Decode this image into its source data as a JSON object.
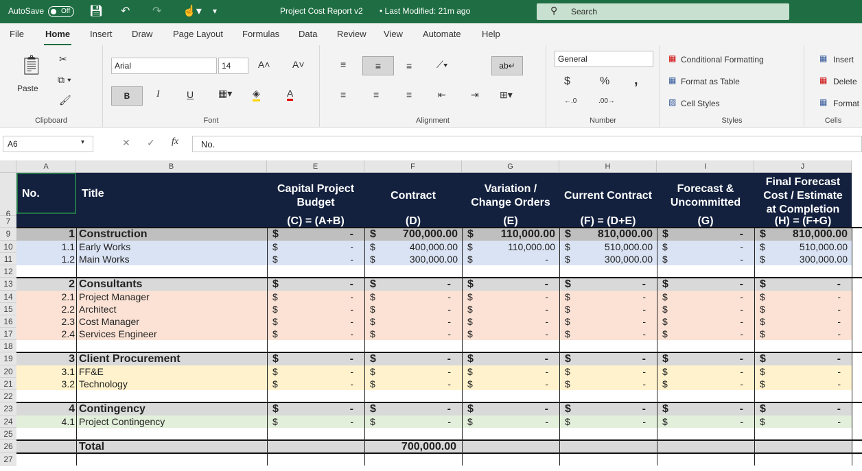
{
  "titlebar": {
    "autosave_label": "AutoSave",
    "autosave_state": "Off",
    "title": "Project Cost Report v2",
    "modified": "• Last Modified: 21m ago",
    "search_placeholder": "Search"
  },
  "menu": [
    "File",
    "Home",
    "Insert",
    "Draw",
    "Page Layout",
    "Formulas",
    "Data",
    "Review",
    "View",
    "Automate",
    "Help"
  ],
  "ribbon": {
    "clipboard": {
      "label": "Clipboard",
      "paste": "Paste"
    },
    "font": {
      "label": "Font",
      "family": "Arial",
      "size": "14",
      "bold": "B",
      "italic": "I",
      "underline": "U"
    },
    "alignment": {
      "label": "Alignment"
    },
    "number": {
      "label": "Number",
      "format": "General",
      "currency": "$",
      "percent": "%",
      "comma": ","
    },
    "styles": {
      "label": "Styles",
      "cond": "Conditional Formatting",
      "table": "Format as Table",
      "cell": "Cell Styles"
    },
    "cells": {
      "label": "Cells",
      "insert": "Insert",
      "delete": "Delete",
      "format": "Format"
    }
  },
  "formula_bar": {
    "name_box": "A6",
    "formula": "No."
  },
  "columns": [
    "A",
    "B",
    "E",
    "F",
    "G",
    "H",
    "I",
    "J"
  ],
  "header": {
    "no": "No.",
    "title": "Title",
    "e": "Capital Project Budget",
    "e_sub": "(C) = (A+B)",
    "f": "Contract",
    "f_sub": "(D)",
    "g": "Variation / Change Orders",
    "g_sub": "(E)",
    "h": "Current Contract",
    "h_sub": "(F) = (D+E)",
    "i": "Forecast & Uncommitted",
    "i_sub": "(G)",
    "j": "Final Forecast Cost / Estimate at Completion",
    "j_sub": "(H) = (F+G)"
  },
  "rows": [
    {
      "r": "9",
      "type": "section",
      "no": "1",
      "title": "Construction",
      "vals": [
        "-",
        "700,000.00",
        "110,000.00",
        "810,000.00",
        "-",
        "810,000.00"
      ],
      "bg": "#bfbfbf"
    },
    {
      "r": "10",
      "type": "item",
      "no": "1.1",
      "title": "Early Works",
      "vals": [
        "-",
        "400,000.00",
        "110,000.00",
        "510,000.00",
        "-",
        "510,000.00"
      ],
      "bg": "#dae3f3"
    },
    {
      "r": "11",
      "type": "item",
      "no": "1.2",
      "title": "Main Works",
      "vals": [
        "-",
        "300,000.00",
        "-",
        "300,000.00",
        "-",
        "300,000.00"
      ],
      "bg": "#dae3f3"
    },
    {
      "r": "12",
      "type": "blank"
    },
    {
      "r": "13",
      "type": "section",
      "no": "2",
      "title": "Consultants",
      "vals": [
        "-",
        "-",
        "-",
        "-",
        "-",
        "-"
      ],
      "bg": "#d9d9d9"
    },
    {
      "r": "14",
      "type": "item",
      "no": "2.1",
      "title": "Project Manager",
      "vals": [
        "-",
        "-",
        "-",
        "-",
        "-",
        "-"
      ],
      "bg": "#fbe2d5"
    },
    {
      "r": "15",
      "type": "item",
      "no": "2.2",
      "title": "Architect",
      "vals": [
        "-",
        "-",
        "-",
        "-",
        "-",
        "-"
      ],
      "bg": "#fbe2d5"
    },
    {
      "r": "16",
      "type": "item",
      "no": "2.3",
      "title": "Cost Manager",
      "vals": [
        "-",
        "-",
        "-",
        "-",
        "-",
        "-"
      ],
      "bg": "#fbe2d5"
    },
    {
      "r": "17",
      "type": "item",
      "no": "2.4",
      "title": "Services Engineer",
      "vals": [
        "-",
        "-",
        "-",
        "-",
        "-",
        "-"
      ],
      "bg": "#fbe2d5"
    },
    {
      "r": "18",
      "type": "blank"
    },
    {
      "r": "19",
      "type": "section",
      "no": "3",
      "title": "Client Procurement",
      "vals": [
        "-",
        "-",
        "-",
        "-",
        "-",
        "-"
      ],
      "bg": "#d9d9d9"
    },
    {
      "r": "20",
      "type": "item",
      "no": "3.1",
      "title": "FF&E",
      "vals": [
        "-",
        "-",
        "-",
        "-",
        "-",
        "-"
      ],
      "bg": "#fff2cc"
    },
    {
      "r": "21",
      "type": "item",
      "no": "3.2",
      "title": "Technology",
      "vals": [
        "-",
        "-",
        "-",
        "-",
        "-",
        "-"
      ],
      "bg": "#fff2cc"
    },
    {
      "r": "22",
      "type": "blank"
    },
    {
      "r": "23",
      "type": "section",
      "no": "4",
      "title": "Contingency",
      "vals": [
        "-",
        "-",
        "-",
        "-",
        "-",
        "-"
      ],
      "bg": "#d9d9d9"
    },
    {
      "r": "24",
      "type": "item",
      "no": "4.1",
      "title": "Project Contingency",
      "vals": [
        "-",
        "-",
        "-",
        "-",
        "-",
        "-"
      ],
      "bg": "#e2efda"
    },
    {
      "r": "25",
      "type": "blank"
    },
    {
      "r": "26",
      "type": "total",
      "title": "Total",
      "f_total": "700,000.00"
    },
    {
      "r": "27",
      "type": "blank"
    }
  ],
  "header_rows": [
    "6",
    "7"
  ],
  "currency_symbol": "$"
}
